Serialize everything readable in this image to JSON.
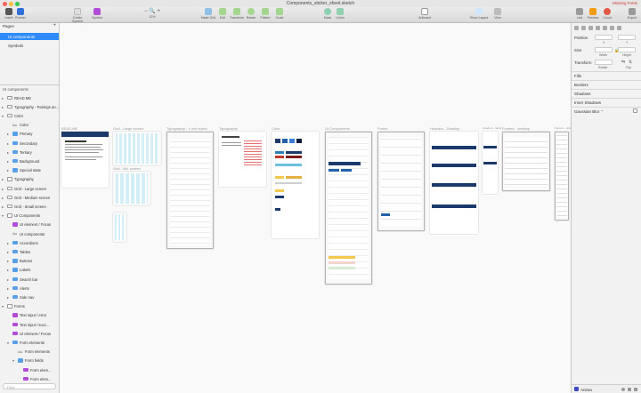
{
  "window": {
    "title": "Components_sticker_sheet.sketch",
    "missing_fonts": "Missing Fonts"
  },
  "toolbar": {
    "insert": "Insert",
    "runner": "Runner",
    "create_symbol": "Create Symbol",
    "symbol": "Symbol",
    "zoom": "12%",
    "zoom_minus": "−",
    "zoom_plus": "+",
    "make_grid": "Make Grid",
    "edit": "Edit",
    "transform": "Transform",
    "rotate": "Rotate",
    "flatten": "Flatten",
    "scale": "Scale",
    "mask": "Mask",
    "union": "Union",
    "artboard": "Artboard",
    "show_layout": "Show Layout",
    "view": "View",
    "link": "Link",
    "preview": "Preview",
    "cloud": "Cloud",
    "export": "Export"
  },
  "sidebar": {
    "pages_header": "Pages",
    "pages": [
      "UI components",
      "Symbols"
    ],
    "layers_header": "UI components",
    "layers": [
      {
        "label": "READ ME",
        "indent": 0,
        "arrow": "▸",
        "icon": "artboard"
      },
      {
        "label": "Typography - Pairings an...",
        "indent": 0,
        "arrow": "▸",
        "icon": "artboard"
      },
      {
        "label": "Color",
        "indent": 0,
        "arrow": "▾",
        "icon": "artboard"
      },
      {
        "label": "Color",
        "indent": 1,
        "arrow": "",
        "icon": "text"
      },
      {
        "label": "Primary",
        "indent": 1,
        "arrow": "▸",
        "icon": "folder"
      },
      {
        "label": "Secondary",
        "indent": 1,
        "arrow": "▸",
        "icon": "folder"
      },
      {
        "label": "Tertiary",
        "indent": 1,
        "arrow": "▸",
        "icon": "folder"
      },
      {
        "label": "Background",
        "indent": 1,
        "arrow": "▸",
        "icon": "folder"
      },
      {
        "label": "Special state",
        "indent": 1,
        "arrow": "▸",
        "icon": "folder"
      },
      {
        "label": "Typography",
        "indent": 0,
        "arrow": "▸",
        "icon": "artboard"
      },
      {
        "label": "Grid - Large screen",
        "indent": 0,
        "arrow": "▸",
        "icon": "artboard"
      },
      {
        "label": "Grid - Medium screen",
        "indent": 0,
        "arrow": "▸",
        "icon": "artboard"
      },
      {
        "label": "Grid - Small screen",
        "indent": 0,
        "arrow": "▸",
        "icon": "artboard"
      },
      {
        "label": "UI Components",
        "indent": 0,
        "arrow": "▾",
        "icon": "artboard"
      },
      {
        "label": "UI element / Focus",
        "indent": 1,
        "arrow": "",
        "icon": "symbol"
      },
      {
        "label": "UI components",
        "indent": 1,
        "arrow": "",
        "icon": "text"
      },
      {
        "label": "Accordions",
        "indent": 1,
        "arrow": "▸",
        "icon": "folder"
      },
      {
        "label": "Tables",
        "indent": 1,
        "arrow": "▸",
        "icon": "folder"
      },
      {
        "label": "Buttons",
        "indent": 1,
        "arrow": "▸",
        "icon": "folder"
      },
      {
        "label": "Labels",
        "indent": 1,
        "arrow": "▸",
        "icon": "folder"
      },
      {
        "label": "Search bar",
        "indent": 1,
        "arrow": "▸",
        "icon": "folder"
      },
      {
        "label": "Alerts",
        "indent": 1,
        "arrow": "▸",
        "icon": "folder"
      },
      {
        "label": "Side nav",
        "indent": 1,
        "arrow": "▸",
        "icon": "folder"
      },
      {
        "label": "Forms",
        "indent": 0,
        "arrow": "▾",
        "icon": "artboard"
      },
      {
        "label": "Text input / error",
        "indent": 1,
        "arrow": "",
        "icon": "symbol"
      },
      {
        "label": "Text input / succ...",
        "indent": 1,
        "arrow": "",
        "icon": "symbol"
      },
      {
        "label": "UI element / Focus",
        "indent": 1,
        "arrow": "",
        "icon": "symbol"
      },
      {
        "label": "Form elements",
        "indent": 1,
        "arrow": "▾",
        "icon": "folder"
      },
      {
        "label": "Form elements",
        "indent": 2,
        "arrow": "",
        "icon": "text"
      },
      {
        "label": "Form fields",
        "indent": 2,
        "arrow": "▾",
        "icon": "folder"
      },
      {
        "label": "Form elem...",
        "indent": 3,
        "arrow": "",
        "icon": "symbol"
      },
      {
        "label": "Form elem...",
        "indent": 3,
        "arrow": "",
        "icon": "symbol"
      }
    ],
    "filter_placeholder": "Filter"
  },
  "canvas": {
    "artboards": [
      {
        "label": "READ ME"
      },
      {
        "label": "Grid - Large screen"
      },
      {
        "label": "Grid - Md. screen"
      },
      {
        "label": "Typography - 4 unit styles"
      },
      {
        "label": "Typography"
      },
      {
        "label": "Color"
      },
      {
        "label": "UI Components"
      },
      {
        "label": "Forms"
      },
      {
        "label": "Headers - Desktop"
      },
      {
        "label": "Headers - tablet"
      },
      {
        "label": "Footers - desktop"
      },
      {
        "label": "Footers - tablet"
      }
    ]
  },
  "inspector": {
    "position": "Position",
    "x": "X",
    "y": "Y",
    "size": "Size",
    "width": "Width",
    "height": "Height",
    "transform": "Transform",
    "rotate": "Rotate",
    "flip": "Flip",
    "fills": "Fills",
    "borders": "Borders",
    "shadows": "Shadows",
    "inner_shadows": "Inner Shadows",
    "gaussian_blur": "Gaussian Blur ⌃",
    "footer": "Anima"
  },
  "colors": {
    "accent": "#2f8bfa",
    "navy": "#1b3a6b",
    "red": "#c0392b",
    "yellow": "#f2c94c",
    "sidebar": "#f2f2f2",
    "canvas": "#f9f9f9"
  }
}
